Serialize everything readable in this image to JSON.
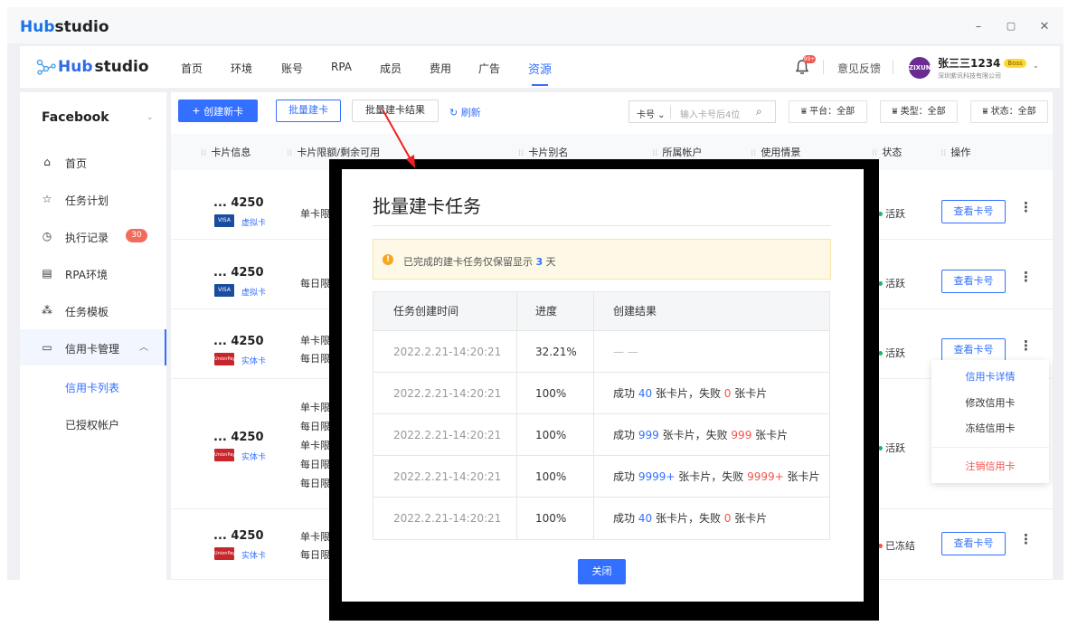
{
  "app": {
    "brand_a": "Hub",
    "brand_b": "studio",
    "min": "–",
    "max": "▢",
    "close": "✕"
  },
  "nav": {
    "logo_a": "Hub",
    "logo_b": "studio",
    "items": [
      "首页",
      "环境",
      "账号",
      "RPA",
      "成员",
      "费用",
      "广告",
      "资源"
    ],
    "active": "资源",
    "bell_badge": "99+",
    "feedback": "意见反馈",
    "avatar": "ZIXUN",
    "user_name": "张三三1234",
    "user_badge": "Boss",
    "company": "深圳紫讯科技有限公司"
  },
  "sidebar": {
    "title": "Facebook",
    "items": [
      {
        "label": "首页",
        "icon": "home-icon"
      },
      {
        "label": "任务计划",
        "icon": "star-icon"
      },
      {
        "label": "执行记录",
        "icon": "clock-icon",
        "badge": "30"
      },
      {
        "label": "RPA环境",
        "icon": "rpa-icon"
      },
      {
        "label": "任务模板",
        "icon": "grid-icon"
      },
      {
        "label": "信用卡管理",
        "icon": "card-icon"
      }
    ],
    "subitems": [
      "信用卡列表",
      "已授权帐户"
    ]
  },
  "toolbar": {
    "create": "创建新卡",
    "batch": "批量建卡",
    "batch_result": "批量建卡结果",
    "refresh": "刷新",
    "search_key": "卡号",
    "search_placeholder": "输入卡号后4位",
    "filters": [
      "平台：全部",
      "类型：全部",
      "状态：全部"
    ]
  },
  "table": {
    "headers": [
      "卡片信息",
      "卡片限额/剩余可用",
      "卡片别名",
      "所属帐户",
      "使用情景",
      "状态",
      "操作"
    ],
    "rows": [
      {
        "num": "... 4250",
        "brand": "VISA",
        "type": "虚拟卡",
        "limits": [
          "单卡限"
        ],
        "status": "活跃",
        "view": "查看卡号"
      },
      {
        "num": "... 4250",
        "brand": "VISA",
        "type": "虚拟卡",
        "limits": [
          "每日限"
        ],
        "status": "活跃",
        "view": "查看卡号"
      },
      {
        "num": "... 4250",
        "brand": "UnionPay",
        "type": "实体卡",
        "limits": [
          "单卡限",
          "每日限"
        ],
        "status": "活跃",
        "view": "查看卡号"
      },
      {
        "num": "... 4250",
        "brand": "UnionPay",
        "type": "实体卡",
        "limits": [
          "单卡限",
          "每日限",
          "单卡限",
          "每日限",
          "每日限"
        ],
        "status": "活跃",
        "view": ""
      },
      {
        "num": "... 4250",
        "brand": "UnionPay",
        "type": "实体卡",
        "limits": [
          "单卡限",
          "每日限"
        ],
        "status": "已冻结",
        "view": "查看卡号"
      }
    ]
  },
  "dropdown": {
    "items": [
      "信用卡详情",
      "修改信用卡",
      "冻结信用卡"
    ],
    "danger": "注销信用卡"
  },
  "modal": {
    "title": "批量建卡任务",
    "notice_pre": "已完成的建卡任务仅保留显示",
    "notice_num": "3",
    "notice_post": "天",
    "headers": [
      "任务创建时间",
      "进度",
      "创建结果"
    ],
    "rows": [
      {
        "time": "2022.2.21-14:20:21",
        "progress": "32.21%",
        "pending": "— —"
      },
      {
        "time": "2022.2.21-14:20:21",
        "progress": "100%",
        "s_pre": "成功",
        "success": "40",
        "mid": "张卡片，失败",
        "fail": "0",
        "post": "张卡片"
      },
      {
        "time": "2022.2.21-14:20:21",
        "progress": "100%",
        "s_pre": "成功",
        "success": "999",
        "mid": "张卡片，失败",
        "fail": "999",
        "post": "张卡片"
      },
      {
        "time": "2022.2.21-14:20:21",
        "progress": "100%",
        "s_pre": "成功",
        "success": "9999+",
        "mid": "张卡片，失败",
        "fail": "9999+",
        "post": "张卡片"
      },
      {
        "time": "2022.2.21-14:20:21",
        "progress": "100%",
        "s_pre": "成功",
        "success": "40",
        "mid": "张卡片，失败",
        "fail": "0",
        "post": "张卡片"
      }
    ],
    "close": "关闭"
  },
  "colors": {
    "accent": "#3370ff",
    "danger": "#f5544d",
    "success": "#22b36b",
    "warn": "#f5a623"
  }
}
